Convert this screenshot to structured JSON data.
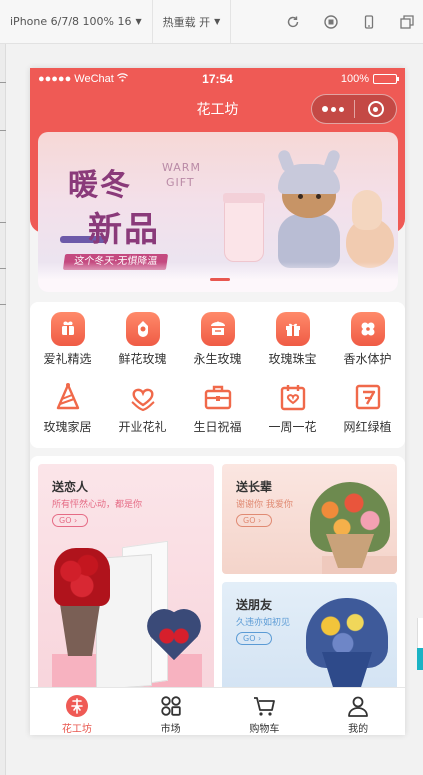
{
  "devtools": {
    "device_select": "iPhone 6/7/8 100% 16",
    "hot_reload_select": "热重载 开"
  },
  "statusbar": {
    "carrier": "●●●●● WeChat",
    "time": "17:54",
    "battery": "100%",
    "battery_level": 1.0
  },
  "navbar": {
    "title": "花工坊"
  },
  "banner": {
    "title_line1": "暖冬",
    "title_line2": "新品",
    "en_line1": "WARM",
    "en_line2": "GIFT",
    "subtitle": "这个冬天·无惧降温"
  },
  "categories": [
    {
      "label": "爱礼精选",
      "icon": "gift-select-icon"
    },
    {
      "label": "鲜花玫瑰",
      "icon": "rose-icon"
    },
    {
      "label": "永生玫瑰",
      "icon": "preserved-rose-icon"
    },
    {
      "label": "玫瑰珠宝",
      "icon": "gift-box-icon"
    },
    {
      "label": "香水体护",
      "icon": "flower-icon"
    },
    {
      "label": "玫瑰家居",
      "icon": "party-hat-icon"
    },
    {
      "label": "开业花礼",
      "icon": "heart-hands-icon"
    },
    {
      "label": "生日祝福",
      "icon": "briefcase-icon"
    },
    {
      "label": "一周一花",
      "icon": "calendar-heart-icon"
    },
    {
      "label": "网红绿植",
      "icon": "plant-icon"
    }
  ],
  "promos": [
    {
      "title": "送恋人",
      "subtitle": "所有怦然心动，都是你",
      "go": "GO",
      "color": "#e56b85"
    },
    {
      "title": "送长辈",
      "subtitle": "谢谢你 我爱你",
      "go": "GO",
      "color": "#e08a73"
    },
    {
      "title": "送朋友",
      "subtitle": "久违亦如初见",
      "go": "GO",
      "color": "#5b9bd5"
    }
  ],
  "tabbar": [
    {
      "label": "花工坊",
      "icon": "home-flower-icon",
      "active": true
    },
    {
      "label": "市场",
      "icon": "market-grid-icon",
      "active": false
    },
    {
      "label": "购物车",
      "icon": "cart-icon",
      "active": false
    },
    {
      "label": "我的",
      "icon": "user-icon",
      "active": false
    }
  ],
  "colors": {
    "brand_red": "#ef5a55",
    "accent_orange": "#f0694a",
    "active_tab": "#e8574f"
  }
}
